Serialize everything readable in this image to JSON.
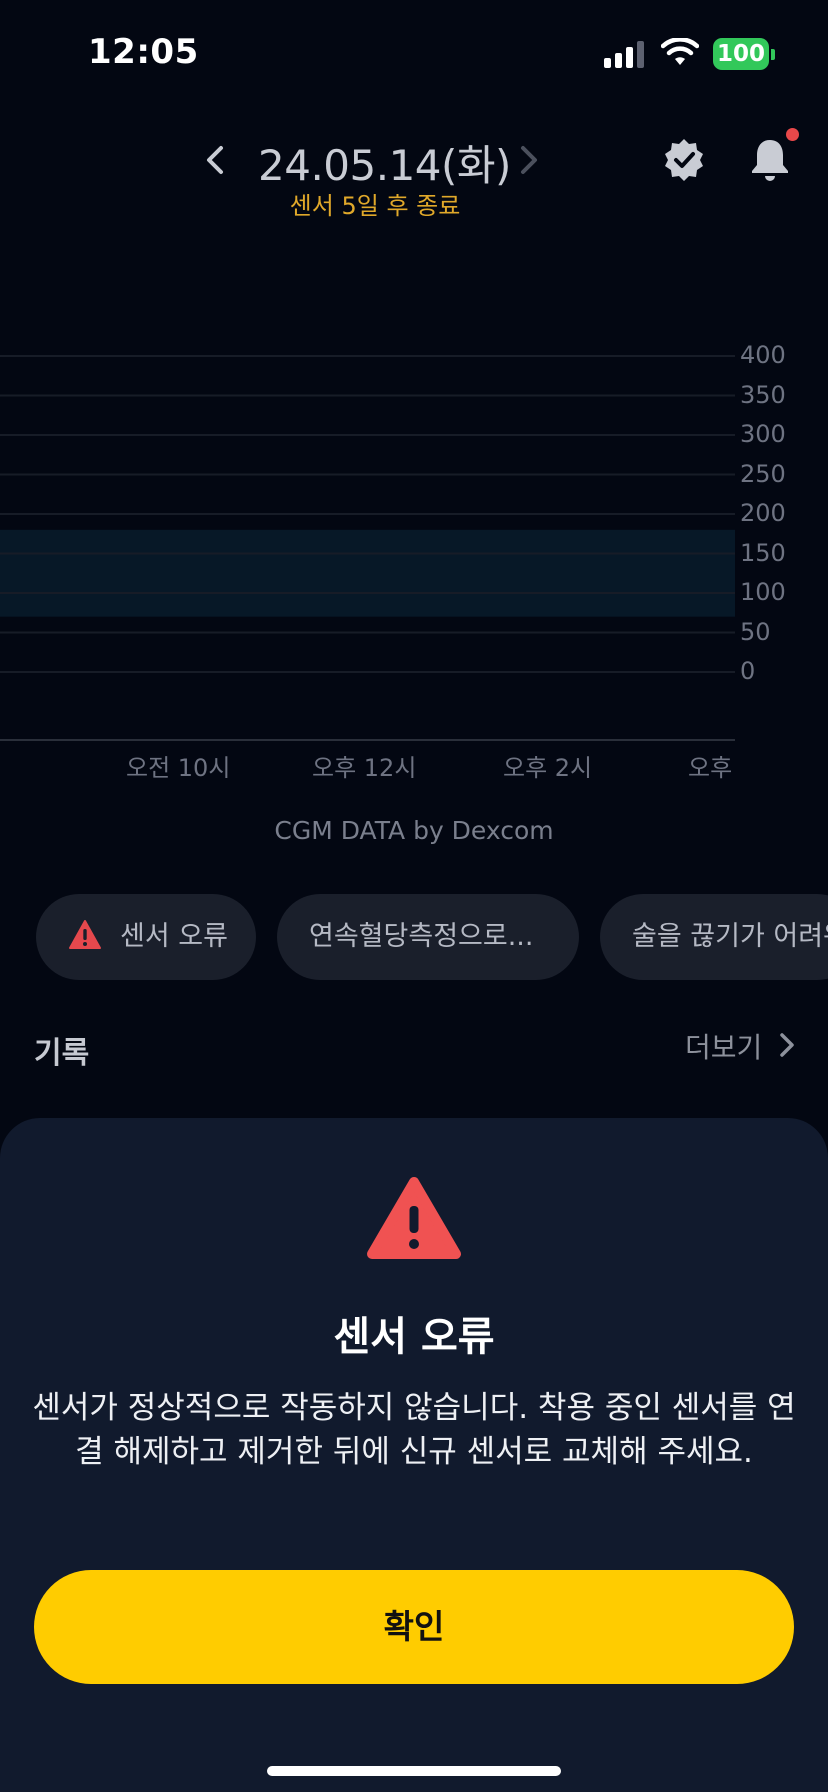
{
  "status_bar": {
    "time": "12:05",
    "battery": "100",
    "icons": [
      "signal-icon",
      "wifi-icon",
      "battery-icon"
    ]
  },
  "header": {
    "date": "24.05.14(화)",
    "sensor_status": "센서 5일 후 종료",
    "icons": [
      "chevron-left-icon",
      "chevron-right-icon",
      "verified-badge-icon",
      "bell-icon"
    ]
  },
  "chart": {
    "y_ticks": [
      "400",
      "350",
      "300",
      "250",
      "200",
      "150",
      "100",
      "50",
      "0"
    ],
    "x_ticks": [
      "오전 10시",
      "오후 12시",
      "오후 2시",
      "오후"
    ],
    "target_range": [
      70,
      180
    ],
    "credit": "CGM DATA by Dexcom"
  },
  "chips": [
    {
      "label": "센서 오류",
      "icon": "warning-icon"
    },
    {
      "label": "연속혈당측정으로..."
    },
    {
      "label": "술을 끊기가 어려워"
    }
  ],
  "records": {
    "title": "기록",
    "more": "더보기"
  },
  "alert_sheet": {
    "icon": "warning-icon",
    "title": "센서 오류",
    "message": "센서가 정상적으로 작동하지 않습니다. 착용 중인 센서를 연결 해제하고 제거한 뒤에 신규 센서로 교체해 주세요.",
    "confirm": "확인"
  },
  "colors": {
    "background": "#030712",
    "accent": "#ffcc00",
    "warning": "#f05252",
    "sensor_status": "#e0a82a"
  }
}
